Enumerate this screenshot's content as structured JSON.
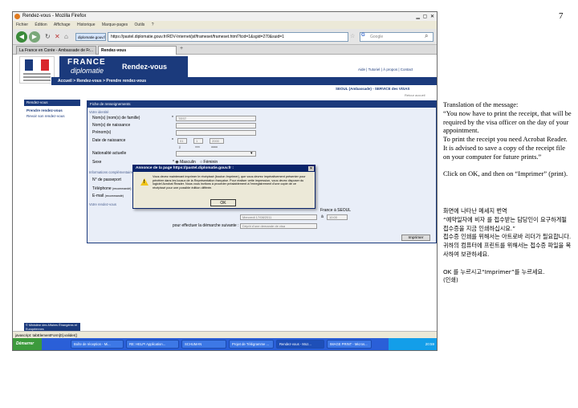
{
  "page_number": "7",
  "browser": {
    "window_title": "Rendez-vous - Mozilla Firefox",
    "menu": [
      "Fichier",
      "Édition",
      "Affichage",
      "Historique",
      "Marque-pages",
      "Outils",
      "?"
    ],
    "url_prefix": "diplomatie.gouv.fr",
    "url": "https://pastel.diplomatie.gouv.fr/RDV-Internet/jsf/frameset/frameset.html?lcid=1&sgid=270&suid=1",
    "search_placeholder": "Google",
    "tabs": [
      {
        "label": "La France en Corée - Ambassade de Fr..."
      },
      {
        "label": "Rendez-vous"
      }
    ],
    "status_text": "javascript: tabElementForm[0].valider()"
  },
  "site": {
    "brand_line1": "FRANCE",
    "brand_line2": "diplomatie",
    "brand_section": "Rendez-vous",
    "top_links": "Aide  |  Tutoriel  |  À propos  |  Contact",
    "breadcrumb": "Accueil > Rendez-vous > Prendre rendez-vous",
    "consulate": "SEOUL (Ambassade) - SERVICE des VISAS",
    "retour": "Retour accueil",
    "sidebar": {
      "heading": "Rendez-vous",
      "items": [
        "Prendre rendez-vous",
        "Revoir son rendez-vous"
      ],
      "footer": "© Ministère des Affaires Étrangères et Européennes"
    }
  },
  "form": {
    "title": "Fiche de renseignements",
    "section_identity": "Votre identité",
    "fields": [
      {
        "label": "Nom(s) (nom(s) de famille)",
        "value": "TEST"
      },
      {
        "label": "Nom(s) de naissance",
        "value": ""
      },
      {
        "label": "Prénom(s)",
        "value": ""
      }
    ],
    "dob_label": "Date de naissance",
    "dob_day": "01",
    "dob_month": "1",
    "dob_year": "2000",
    "dob_hints": [
      "jj",
      "mm",
      "aaaa"
    ],
    "nationality_label": "Nationalité actuelle",
    "sex_label": "Sexe",
    "sex_male": "Masculin",
    "sex_female": "Féminin",
    "section_info": "Informations complémentaires",
    "passport_label": "N° de passeport",
    "phone_label": "Téléphone",
    "phone_hint": "(recommandé)",
    "email_label": "E-mail",
    "email_hint": "(recommandé)",
    "section_rdv": "Votre rendez-vous",
    "rdv_place": "France à SEOUL",
    "rdv_date": "Mercredi 17/08/2011",
    "rdv_time_label": "à",
    "rdv_time": "10:00",
    "purpose_label": "pour effectuer la démarche suivante :",
    "purpose_value": "Dépôt d'une demande de visa",
    "imprimer": "Imprimer"
  },
  "dialog": {
    "title": "Annonce de la page https://pastel.diplomatie.gouv.fr :",
    "message": "Vous devez maintenant imprimer le récépissé (bouton Imprimer), que vous devrez impérativement présenter pour pénétrer dans les locaux de la Représentation française. Pour réaliser cette impression, vous devez disposer du logiciel Acrobat Reader. Nous vous invitons à procéder préalablement à l'enregistrement d'une copie de ce récépissé pour une possible édition différée.",
    "ok": "OK"
  },
  "taskbar": {
    "start": "Démarrer",
    "tasks": [
      "Boîte de réception - Mi...",
      "RE: HELP! Application...",
      "SCHUMAN",
      "Projet de Télégramme ...",
      "Rendez-vous - Moz...",
      "IMAGE PRINT - Micros..."
    ],
    "clock": "20:59"
  },
  "notes": {
    "english": "Translation of the message:\n“You now have to print the receipt, that will be required by the visa officer on the day of your appointment.\nTo print the receipt you need Acrobat Reader. It is advised to save a copy of the receipt file on your computer for future prints.”\n\nClick on OK, and then on “Imprimer” (print).",
    "korean": "화면에 나타난 메세지 번역\n“예약일자에 비자 를 접수받는 담당인이 요구하게될 접수증을 지금 인쇄하십시요.”\n접수증 인쇄를 위해서는 아트로바 리더가 필요합니다. 귀하의 컴퓨터에 프린트를 위해서는 접수증 파일을 복사하여 보관하세요.\n\nOK 를 누르시고“Imprimer”를 누르세요.\n(인쇄)"
  }
}
